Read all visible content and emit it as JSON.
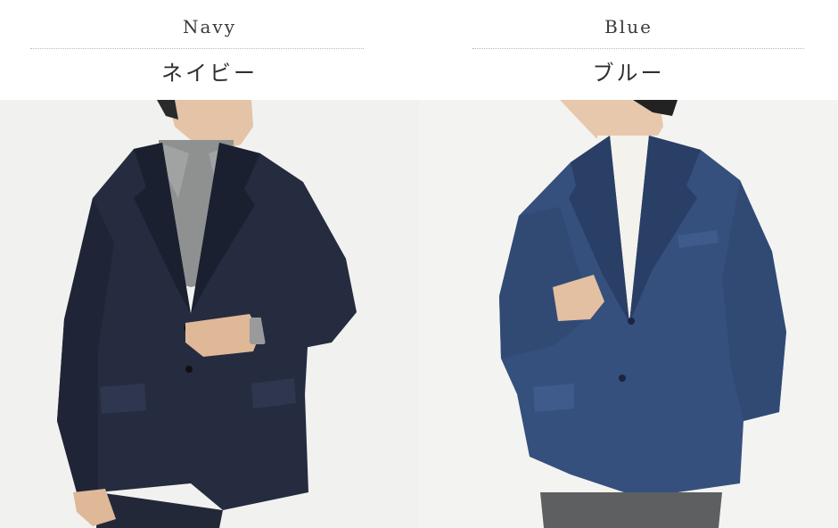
{
  "products": [
    {
      "color_en": "Navy",
      "color_ja": "ネイビー",
      "colors": {
        "jacket": "#262c3f",
        "jacket_shade": "#1b2030",
        "shirt": "#8e9190",
        "background": "#f1f1f0"
      }
    },
    {
      "color_en": "Blue",
      "color_ja": "ブルー",
      "colors": {
        "jacket": "#36507d",
        "jacket_shade": "#2a3f66",
        "shirt": "#f4f2ec",
        "background": "#f3f3f2"
      }
    }
  ]
}
